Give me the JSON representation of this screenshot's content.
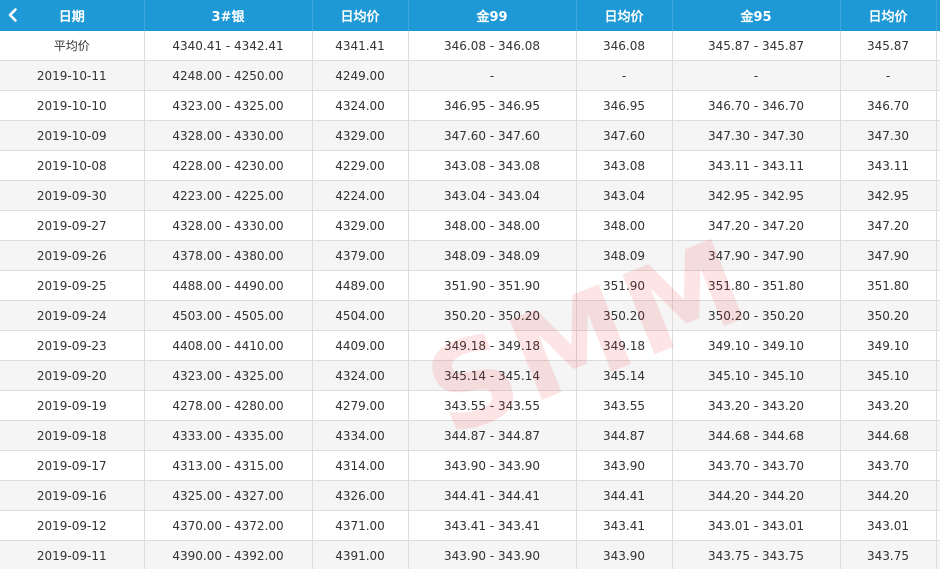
{
  "header": {
    "columns": [
      "日期",
      "3#银",
      "日均价",
      "金99",
      "日均价",
      "金95",
      "日均价"
    ],
    "back_icon": "chevron-left-icon"
  },
  "rows": [
    [
      "平均价",
      "4340.41 - 4342.41",
      "4341.41",
      "346.08 - 346.08",
      "346.08",
      "345.87 - 345.87",
      "345.87"
    ],
    [
      "2019-10-11",
      "4248.00 - 4250.00",
      "4249.00",
      "-",
      "-",
      "-",
      "-"
    ],
    [
      "2019-10-10",
      "4323.00 - 4325.00",
      "4324.00",
      "346.95 - 346.95",
      "346.95",
      "346.70 - 346.70",
      "346.70"
    ],
    [
      "2019-10-09",
      "4328.00 - 4330.00",
      "4329.00",
      "347.60 - 347.60",
      "347.60",
      "347.30 - 347.30",
      "347.30"
    ],
    [
      "2019-10-08",
      "4228.00 - 4230.00",
      "4229.00",
      "343.08 - 343.08",
      "343.08",
      "343.11 - 343.11",
      "343.11"
    ],
    [
      "2019-09-30",
      "4223.00 - 4225.00",
      "4224.00",
      "343.04 - 343.04",
      "343.04",
      "342.95 - 342.95",
      "342.95"
    ],
    [
      "2019-09-27",
      "4328.00 - 4330.00",
      "4329.00",
      "348.00 - 348.00",
      "348.00",
      "347.20 - 347.20",
      "347.20"
    ],
    [
      "2019-09-26",
      "4378.00 - 4380.00",
      "4379.00",
      "348.09 - 348.09",
      "348.09",
      "347.90 - 347.90",
      "347.90"
    ],
    [
      "2019-09-25",
      "4488.00 - 4490.00",
      "4489.00",
      "351.90 - 351.90",
      "351.90",
      "351.80 - 351.80",
      "351.80"
    ],
    [
      "2019-09-24",
      "4503.00 - 4505.00",
      "4504.00",
      "350.20 - 350.20",
      "350.20",
      "350.20 - 350.20",
      "350.20"
    ],
    [
      "2019-09-23",
      "4408.00 - 4410.00",
      "4409.00",
      "349.18 - 349.18",
      "349.18",
      "349.10 - 349.10",
      "349.10"
    ],
    [
      "2019-09-20",
      "4323.00 - 4325.00",
      "4324.00",
      "345.14 - 345.14",
      "345.14",
      "345.10 - 345.10",
      "345.10"
    ],
    [
      "2019-09-19",
      "4278.00 - 4280.00",
      "4279.00",
      "343.55 - 343.55",
      "343.55",
      "343.20 - 343.20",
      "343.20"
    ],
    [
      "2019-09-18",
      "4333.00 - 4335.00",
      "4334.00",
      "344.87 - 344.87",
      "344.87",
      "344.68 - 344.68",
      "344.68"
    ],
    [
      "2019-09-17",
      "4313.00 - 4315.00",
      "4314.00",
      "343.90 - 343.90",
      "343.90",
      "343.70 - 343.70",
      "343.70"
    ],
    [
      "2019-09-16",
      "4325.00 - 4327.00",
      "4326.00",
      "344.41 - 344.41",
      "344.41",
      "344.20 - 344.20",
      "344.20"
    ],
    [
      "2019-09-12",
      "4370.00 - 4372.00",
      "4371.00",
      "343.41 - 343.41",
      "343.41",
      "343.01 - 343.01",
      "343.01"
    ],
    [
      "2019-09-11",
      "4390.00 - 4392.00",
      "4391.00",
      "343.90 - 343.90",
      "343.90",
      "343.75 - 343.75",
      "343.75"
    ]
  ],
  "watermark": "SMM",
  "colors": {
    "header_bg": "#1f99d6",
    "header_text": "#ffffff",
    "row_alt": "#f5f5f5",
    "watermark": "#ec2828"
  }
}
